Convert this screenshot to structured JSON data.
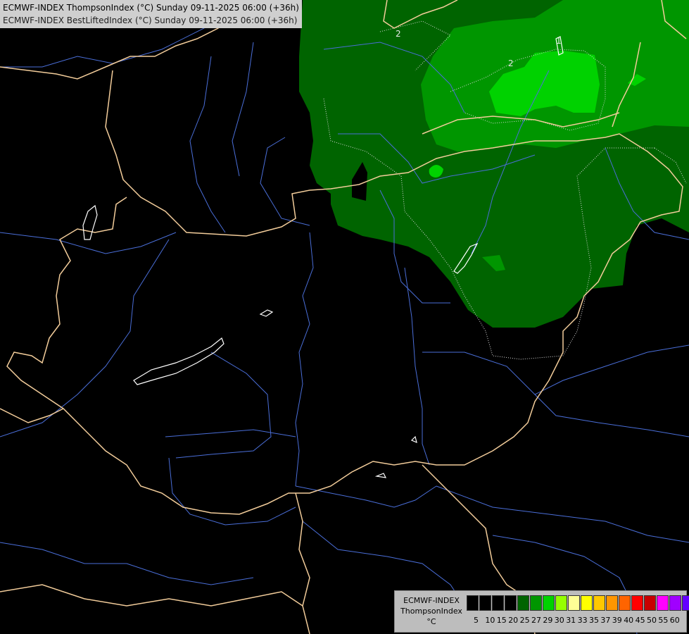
{
  "header": {
    "line1": "ECMWF-INDEX ThompsonIndex (°C) Sunday 09-11-2025 06:00 (+36h)",
    "line2": "ECMWF-INDEX BestLiftedIndex (°C) Sunday 09-11-2025 06:00 (+36h)"
  },
  "map": {
    "contour_labels": [
      "2",
      "2",
      "1"
    ],
    "colors": {
      "background": "#000000",
      "borders": "#f5d2a0",
      "rivers": "#4a6ed8",
      "lakes": "#ffffff",
      "shade_20": "#006400",
      "shade_25": "#009600",
      "shade_27": "#00d200"
    }
  },
  "legend": {
    "label_line1": "ECMWF-INDEX",
    "label_line2": "ThompsonIndex",
    "label_line3": "°C",
    "ticks": [
      "5",
      "10",
      "15",
      "20",
      "25",
      "27",
      "29",
      "30",
      "31",
      "33",
      "35",
      "37",
      "39",
      "40",
      "45",
      "50",
      "55",
      "60"
    ],
    "colors": [
      "#000000",
      "#000000",
      "#000000",
      "#000000",
      "#006400",
      "#009600",
      "#00d200",
      "#96ff00",
      "#ffff96",
      "#ffff00",
      "#ffc800",
      "#ff9600",
      "#ff6400",
      "#ff0000",
      "#c80000",
      "#ff00ff",
      "#a000ff",
      "#6400ff",
      "#0000ff"
    ]
  }
}
